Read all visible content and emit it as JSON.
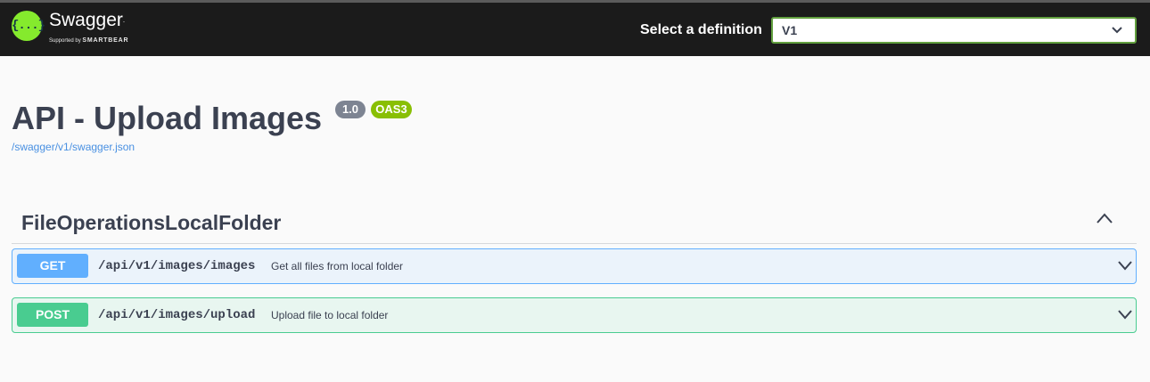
{
  "topbar": {
    "brand": "Swagger",
    "brand_sub_prefix": "Supported by",
    "brand_sub_company": "SMARTBEAR",
    "logo_glyph": "{...}",
    "definition_label": "Select a definition",
    "definition_value": "V1",
    "icons": [
      "swagger-logo-icon",
      "chevron-down-icon"
    ]
  },
  "info": {
    "title": "API - Upload Images",
    "version": "1.0",
    "oas": "OAS3",
    "spec_url": "/swagger/v1/swagger.json"
  },
  "tag": {
    "name": "FileOperationsLocalFolder",
    "toggle_icon": "chevron-up-icon"
  },
  "operations": [
    {
      "method": "GET",
      "path": "/api/v1/images/images",
      "summary": "Get all files from local folder",
      "color": "#61affe"
    },
    {
      "method": "POST",
      "path": "/api/v1/images/upload",
      "summary": "Upload file to local folder",
      "color": "#49cc90"
    }
  ],
  "colors": {
    "topbar_bg": "#1b1b1b",
    "logo": "#85ea2d",
    "select_border": "#62a03f",
    "version_badge": "#7d8492",
    "oas_badge": "#89bf04",
    "link": "#4990e2"
  }
}
